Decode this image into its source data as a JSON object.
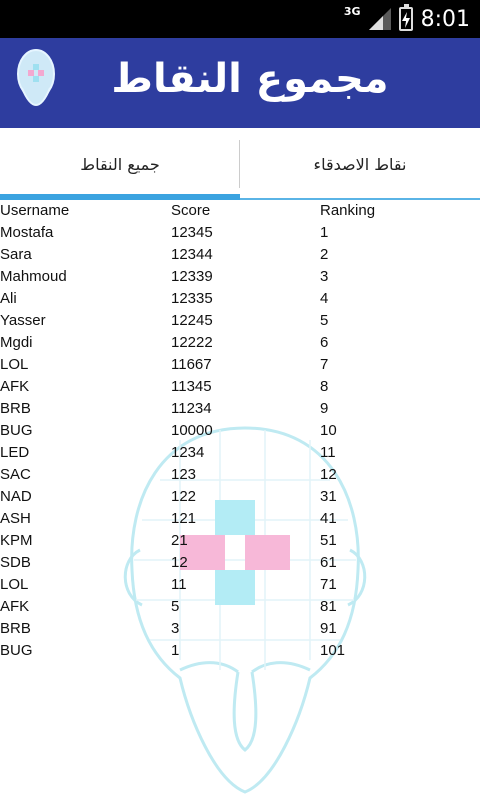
{
  "status_bar": {
    "network": "3G",
    "time": "8:01"
  },
  "app_bar": {
    "title": "مجموع النقاط"
  },
  "tabs": [
    {
      "label": "جميع النقاط",
      "selected": true
    },
    {
      "label": "نقاط الاصدقاء",
      "selected": false
    }
  ],
  "table": {
    "headers": [
      "Username",
      "Score",
      "Ranking"
    ],
    "rows": [
      [
        "Mostafa",
        "12345",
        "1"
      ],
      [
        "Sara",
        "12344",
        "2"
      ],
      [
        "Mahmoud",
        "12339",
        "3"
      ],
      [
        "Ali",
        "12335",
        "4"
      ],
      [
        "Yasser",
        "12245",
        "5"
      ],
      [
        "Mgdi",
        "12222",
        "6"
      ],
      [
        "LOL",
        "11667",
        "7"
      ],
      [
        "AFK",
        "11345",
        "8"
      ],
      [
        "BRB",
        "11234",
        "9"
      ],
      [
        "BUG",
        "10000",
        "10"
      ],
      [
        "LED",
        "1234",
        "11"
      ],
      [
        "SAC",
        "123",
        "12"
      ],
      [
        "NAD",
        "122",
        "31"
      ],
      [
        "ASH",
        "121",
        "41"
      ],
      [
        "KPM",
        "21",
        "51"
      ],
      [
        "SDB",
        "12",
        "61"
      ],
      [
        "LOL",
        "11",
        "71"
      ],
      [
        "AFK",
        "5",
        "81"
      ],
      [
        "BRB",
        "3",
        "91"
      ],
      [
        "BUG",
        "1",
        "101"
      ]
    ]
  },
  "colors": {
    "app_bar": "#2e3d9f",
    "tab_indicator": "#3ba3e0"
  },
  "icons": {
    "logo": "puzzle-head-icon",
    "background": "puzzle-head-illustration"
  }
}
